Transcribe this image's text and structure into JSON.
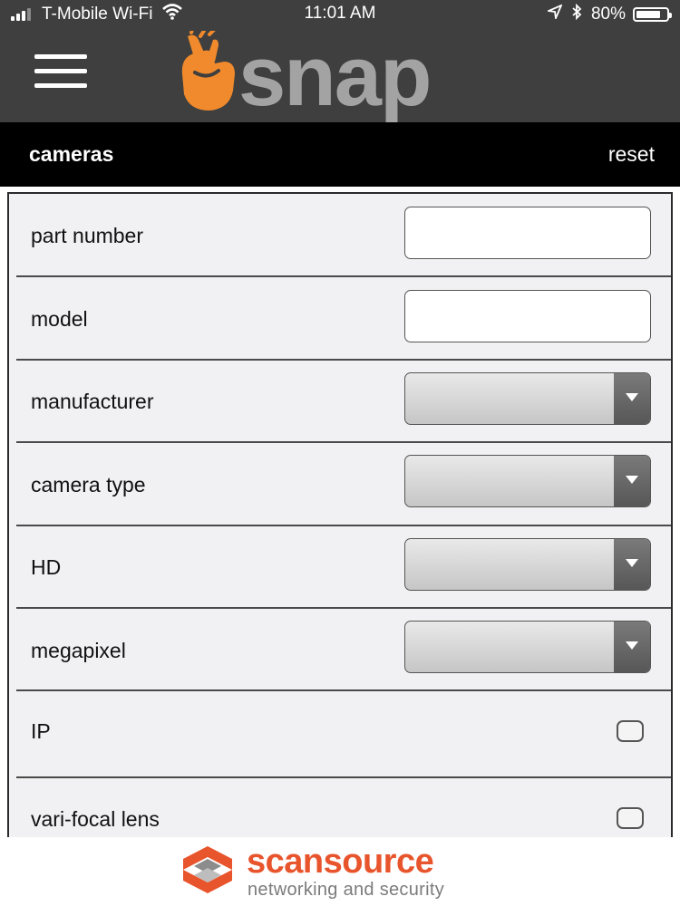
{
  "status_bar": {
    "carrier": "T-Mobile Wi-Fi",
    "time": "11:01 AM",
    "battery": "80%",
    "battery_level": 0.8,
    "icons": [
      "signal-icon",
      "wifi-icon",
      "location-icon",
      "bluetooth-icon",
      "battery-icon"
    ]
  },
  "header": {
    "logo_text": "snap",
    "menu_icon": "hamburger-menu-icon",
    "logo_icon": "snapping-hand-icon",
    "colors": {
      "background": "#3f3f3f",
      "logo_orange": "#f08a2c",
      "logo_gray": "#a3a3a3"
    }
  },
  "toolbar": {
    "title": "cameras",
    "reset_label": "reset"
  },
  "form": {
    "fields": [
      {
        "label": "part number",
        "control": "text",
        "value": ""
      },
      {
        "label": "model",
        "control": "text",
        "value": ""
      },
      {
        "label": "manufacturer",
        "control": "select",
        "value": ""
      },
      {
        "label": "camera type",
        "control": "select",
        "value": ""
      },
      {
        "label": "HD",
        "control": "select",
        "value": ""
      },
      {
        "label": "megapixel",
        "control": "select",
        "value": ""
      },
      {
        "label": "IP",
        "control": "checkbox",
        "checked": false
      },
      {
        "label": "vari-focal lens",
        "control": "checkbox",
        "checked": false
      }
    ]
  },
  "footer": {
    "brand_part1": "scan",
    "brand_part2": "source",
    "tagline": "networking and security",
    "colors": {
      "brand": "#e8542c",
      "tagline": "#7b7b7b"
    }
  }
}
